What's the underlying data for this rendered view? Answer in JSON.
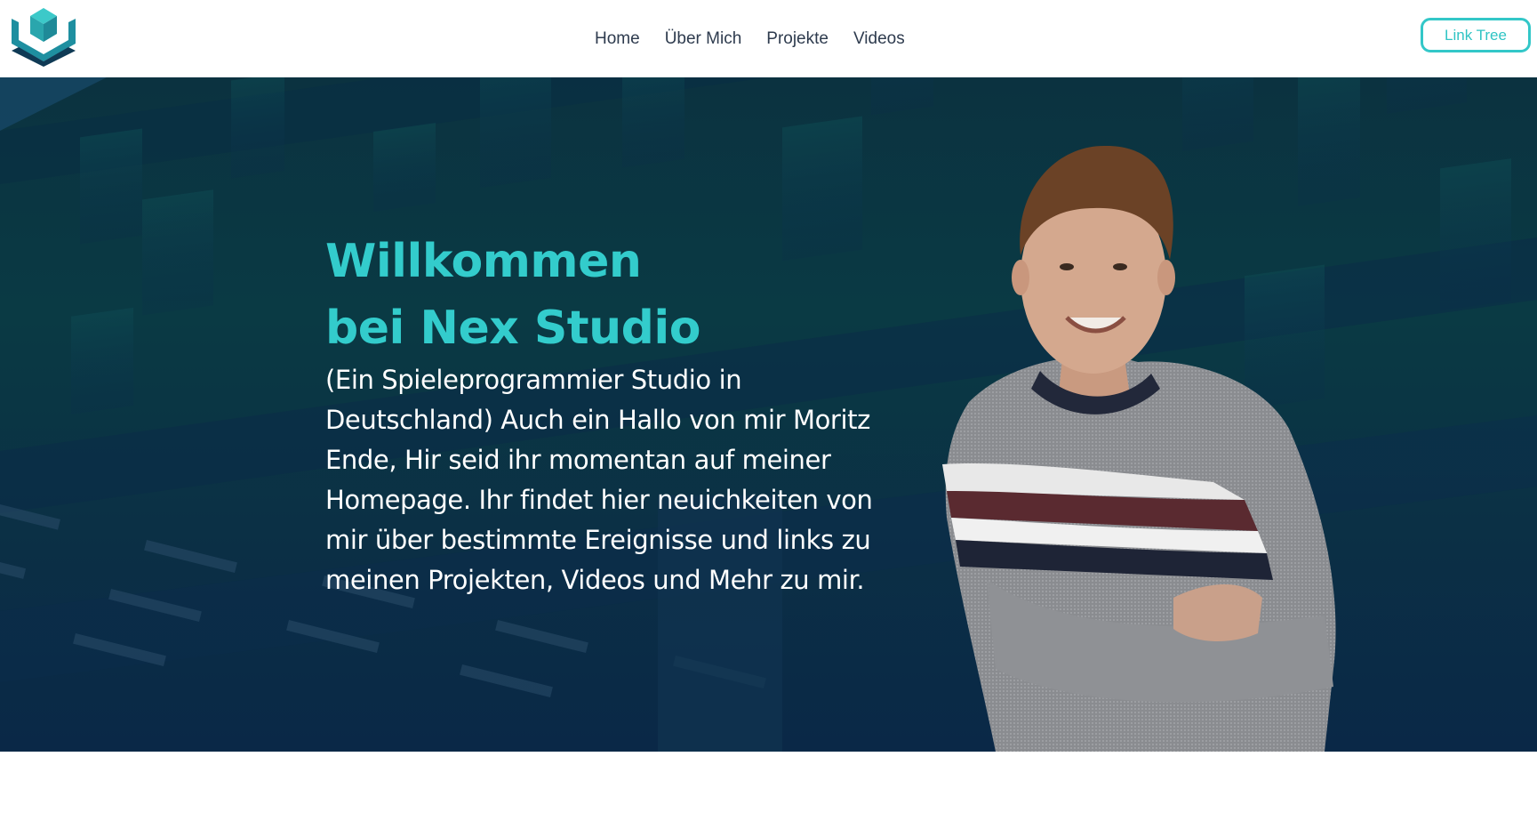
{
  "nav": {
    "logo_name": "hex-cube-logo-icon",
    "links": [
      "Home",
      "Über Mich",
      "Projekte",
      "Videos"
    ],
    "cta_label": "Link Tree"
  },
  "hero": {
    "title_line1": "Willkommen",
    "title_line2": "bei Nex Studio",
    "text": "(Ein Spieleprogrammier Studio in Deutschland) Auch ein Hallo von mir Moritz Ende, Hir seid ihr momentan auf meiner Homepage. Ihr findet hier neuichkeiten von mir über bestimmte Ereignisse und links zu meinen Projekten, Videos und Mehr zu mir."
  },
  "colors": {
    "accent": "#33cccc",
    "hero_bg": "#0b3240",
    "nav_text": "#2e3b4e"
  }
}
